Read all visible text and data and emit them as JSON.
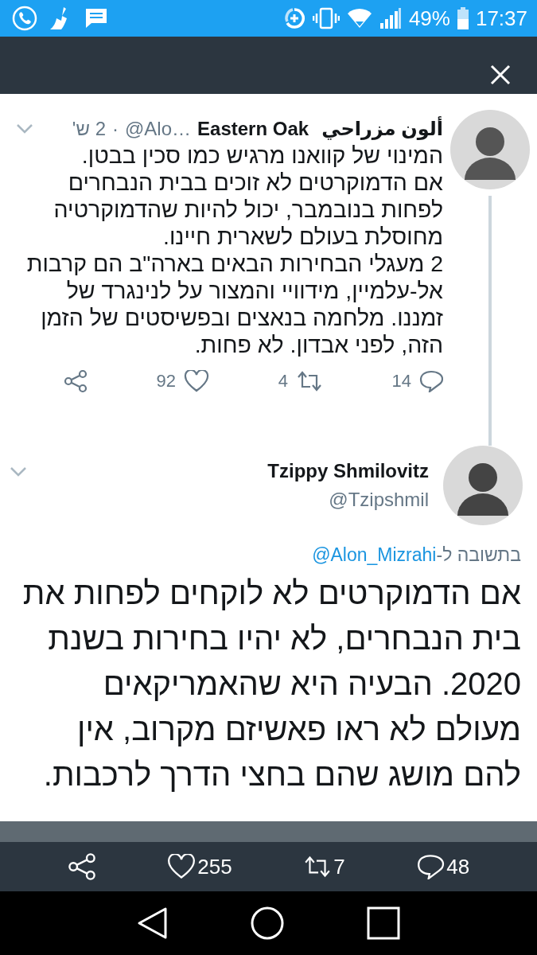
{
  "status_bar": {
    "battery": "49%",
    "time": "17:37"
  },
  "tweets": [
    {
      "name": "ألون مزراحي",
      "name_latin": "Eastern Oak",
      "handle": "@Alo…",
      "separator": "·",
      "time": "2 ש'",
      "text": "המינוי של קוואנו מרגיש כמו סכין בבטן.\nאם הדמוקרטים לא זוכים בבית הנבחרים לפחות בנובמבר, יכול להיות שהדמוקרטיה מחוסלת בעולם לשארית חיינו.\n2 מעגלי הבחירות הבאים בארה\"ב הם קרבות אל-עלמיין, מידוויי והמצור על לנינגרד של זמננו. מלחמה בנאצים ובפשיסטים של הזמן הזה, לפני אבדון. לא פחות.",
      "replies": "14",
      "retweets": "4",
      "likes": "92"
    }
  ],
  "focused_tweet": {
    "name": "Tzippy Shmilovitz",
    "handle": "@Tzipshmil",
    "reply_prefix": "בתשובה ל-",
    "reply_to": "@Alon_Mizrahi",
    "text": "אם הדמוקרטים לא לוקחים לפחות את בית הנבחרים, לא יהיו בחירות בשנת 2020. הבעיה היא שהאמריקאים מעולם לא ראו פאשיזם מקרוב, אין להם מושג שהם בחצי הדרך לרכבות."
  },
  "action_bar": {
    "likes": "255",
    "retweets": "7",
    "replies": "48"
  }
}
